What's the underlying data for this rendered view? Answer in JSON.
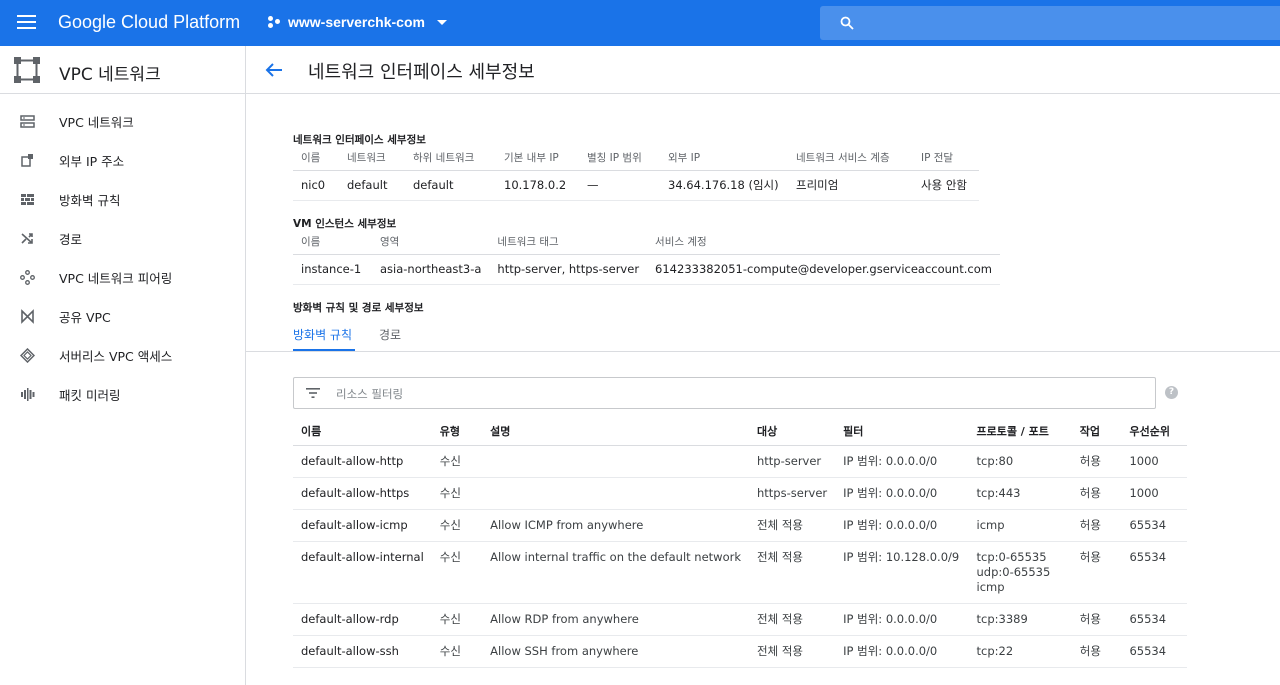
{
  "topbar": {
    "brand": "Google Cloud Platform",
    "project": "www-serverchk-com"
  },
  "sidebar": {
    "title": "VPC 네트워크",
    "items": [
      {
        "label": "VPC 네트워크",
        "icon": "vpc-network-icon"
      },
      {
        "label": "외부 IP 주소",
        "icon": "external-ip-icon"
      },
      {
        "label": "방화벽 규칙",
        "icon": "firewall-icon"
      },
      {
        "label": "경로",
        "icon": "routes-icon"
      },
      {
        "label": "VPC 네트워크 피어링",
        "icon": "peering-icon"
      },
      {
        "label": "공유 VPC",
        "icon": "shared-vpc-icon"
      },
      {
        "label": "서버리스 VPC 액세스",
        "icon": "serverless-icon"
      },
      {
        "label": "패킷 미러링",
        "icon": "packet-mirroring-icon"
      }
    ]
  },
  "page": {
    "title": "네트워크 인터페이스 세부정보"
  },
  "interface": {
    "section_title": "네트워크 인터페이스 세부정보",
    "headers": [
      "이름",
      "네트워크",
      "하위 네트워크",
      "기본 내부 IP",
      "별칭 IP 범위",
      "외부 IP",
      "네트워크 서비스 계층",
      "IP 전달"
    ],
    "row": [
      "nic0",
      "default",
      "default",
      "10.178.0.2",
      "—",
      "34.64.176.18 (임시)",
      "프리미엄",
      "사용 안함"
    ]
  },
  "vm": {
    "section_title": "VM 인스턴스 세부정보",
    "headers": [
      "이름",
      "영역",
      "네트워크 태그",
      "서비스 계정"
    ],
    "row": [
      "instance-1",
      "asia-northeast3-a",
      "http-server, https-server",
      "614233382051-compute@developer.gserviceaccount.com"
    ]
  },
  "rules_section": {
    "title": "방화벽 규칙 및 경로 세부정보",
    "tabs": [
      "방화벽 규칙",
      "경로"
    ],
    "active_tab": 0,
    "filter_placeholder": "리소스 필터링"
  },
  "rules": {
    "headers": [
      "이름",
      "유형",
      "설명",
      "대상",
      "필터",
      "프로토콜 / 포트",
      "작업",
      "우선순위"
    ],
    "rows": [
      {
        "name": "default-allow-http",
        "type": "수신",
        "desc": "",
        "target": "http-server",
        "filter": "IP 범위: 0.0.0.0/0",
        "proto": [
          "tcp:80"
        ],
        "action": "허용",
        "priority": "1000"
      },
      {
        "name": "default-allow-https",
        "type": "수신",
        "desc": "",
        "target": "https-server",
        "filter": "IP 범위: 0.0.0.0/0",
        "proto": [
          "tcp:443"
        ],
        "action": "허용",
        "priority": "1000"
      },
      {
        "name": "default-allow-icmp",
        "type": "수신",
        "desc": "Allow ICMP from anywhere",
        "target": "전체 적용",
        "filter": "IP 범위: 0.0.0.0/0",
        "proto": [
          "icmp"
        ],
        "action": "허용",
        "priority": "65534"
      },
      {
        "name": "default-allow-internal",
        "type": "수신",
        "desc": "Allow internal traffic on the default network",
        "target": "전체 적용",
        "filter": "IP 범위: 10.128.0.0/9",
        "proto": [
          "tcp:0-65535",
          "udp:0-65535",
          "icmp"
        ],
        "action": "허용",
        "priority": "65534"
      },
      {
        "name": "default-allow-rdp",
        "type": "수신",
        "desc": "Allow RDP from anywhere",
        "target": "전체 적용",
        "filter": "IP 범위: 0.0.0.0/0",
        "proto": [
          "tcp:3389"
        ],
        "action": "허용",
        "priority": "65534"
      },
      {
        "name": "default-allow-ssh",
        "type": "수신",
        "desc": "Allow SSH from anywhere",
        "target": "전체 적용",
        "filter": "IP 범위: 0.0.0.0/0",
        "proto": [
          "tcp:22"
        ],
        "action": "허용",
        "priority": "65534"
      }
    ]
  },
  "colors": {
    "brand_blue": "#1a73e8",
    "text": "#202124",
    "muted": "#5f6368"
  }
}
